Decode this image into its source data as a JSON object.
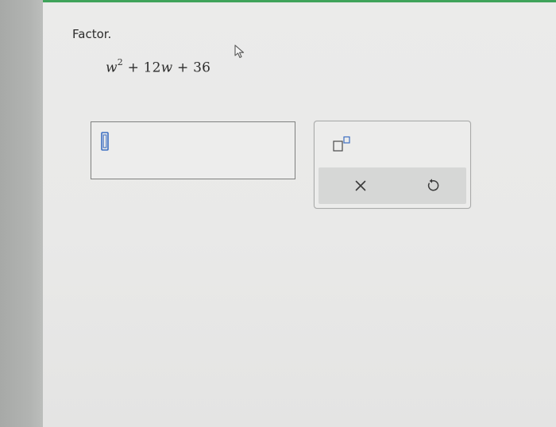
{
  "question": {
    "prompt": "Factor.",
    "expression": {
      "variable": "w",
      "exponent": "2",
      "middle": " + 12",
      "middle_variable": "w",
      "constant": " + 36"
    }
  },
  "answer": {
    "value": ""
  },
  "toolbar": {
    "exponent_tool": "superscript-template-icon",
    "clear": "clear-icon",
    "undo": "undo-icon"
  },
  "colors": {
    "accent": "#3fa35a",
    "text": "#2b2b2b",
    "panel": "#ececeb",
    "action_bar": "#d6d7d6"
  }
}
